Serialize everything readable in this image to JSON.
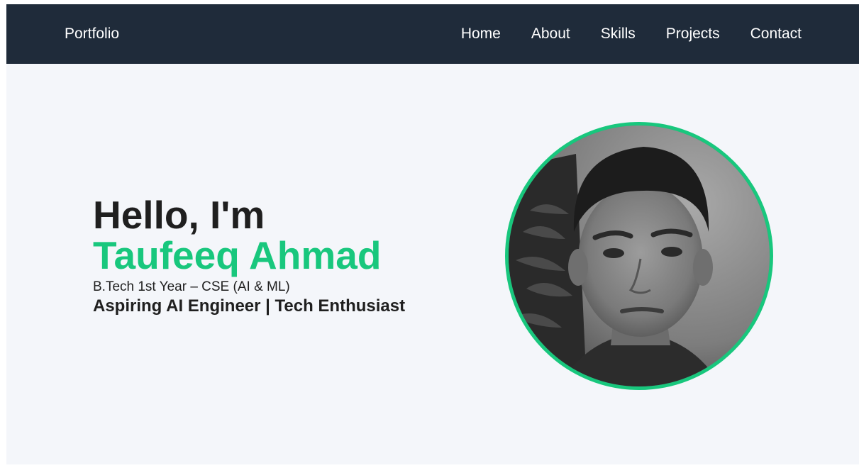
{
  "nav": {
    "brand": "Portfolio",
    "links": [
      "Home",
      "About",
      "Skills",
      "Projects",
      "Contact"
    ]
  },
  "hero": {
    "greeting": "Hello, I'm",
    "name": "Taufeeq Ahmad",
    "degree": "B.Tech 1st Year – CSE (AI & ML)",
    "tagline": "Aspiring AI Engineer | Tech Enthusiast"
  },
  "colors": {
    "navbar_bg": "#1f2b3a",
    "accent": "#18c77d",
    "page_bg": "#f4f6fa",
    "text": "#1f1f1f"
  },
  "icons": {
    "avatar": "profile-photo"
  }
}
